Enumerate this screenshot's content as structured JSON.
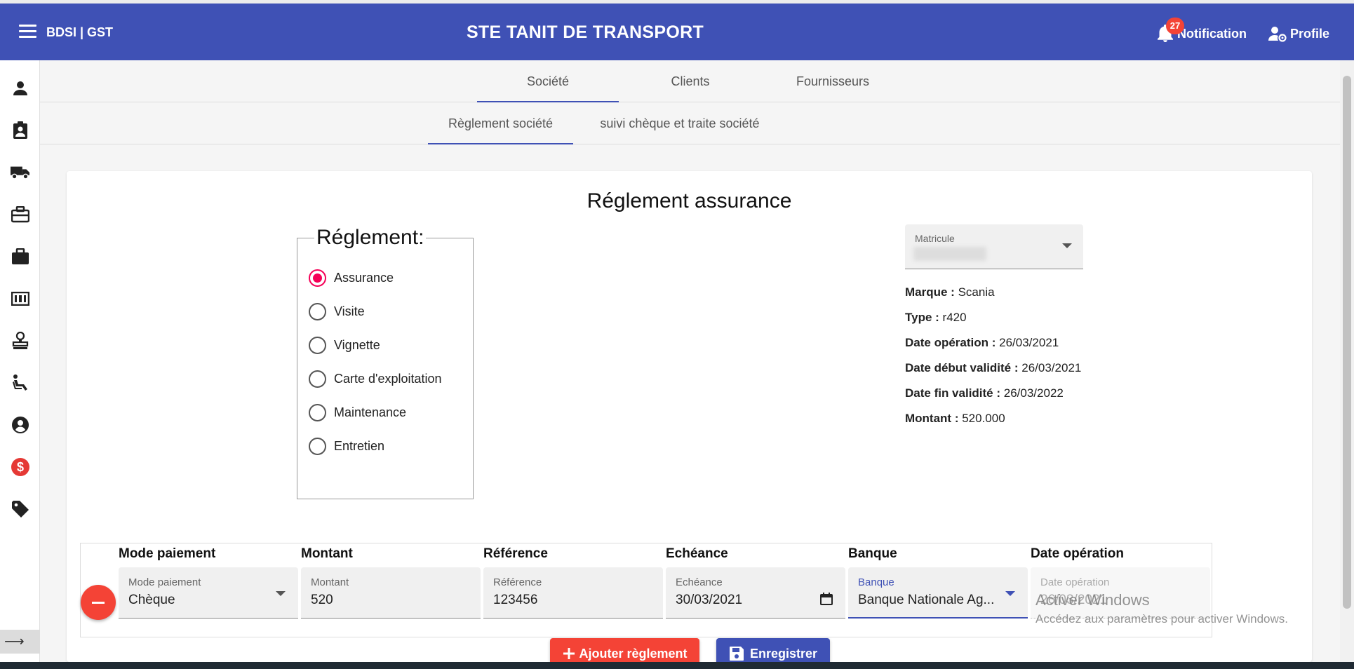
{
  "appbar": {
    "brand": "BDSI | GST",
    "title": "STE TANIT DE TRANSPORT",
    "notification_count": "27",
    "notification_label": "Notification",
    "profile_label": "Profile",
    "color": "#3f51b5"
  },
  "sidebar": {
    "icons": [
      "person-icon",
      "assignment-ind-icon",
      "truck-icon",
      "toolbox-icon",
      "briefcase-icon",
      "pallet-icon",
      "stamp-icon",
      "seat-icon",
      "account-circle-icon",
      "dollar-icon",
      "tag-icon"
    ],
    "collapse_label": "⟶"
  },
  "tabs": {
    "main": [
      "Société",
      "Clients",
      "Fournisseurs"
    ],
    "sub": [
      "Règlement société",
      "suivi chèque et traite société"
    ]
  },
  "card": {
    "title": "Réglement assurance"
  },
  "reglement": {
    "legend": "Réglement:",
    "options": [
      "Assurance",
      "Visite",
      "Vignette",
      "Carte d'exploitation",
      "Maintenance",
      "Entretien"
    ],
    "selected": "Assurance"
  },
  "vehicle": {
    "matricule_label": "Matricule",
    "marque_label": "Marque :",
    "marque": "Scania",
    "type_label": "Type :",
    "type": "r420",
    "date_operation_label": "Date opération :",
    "date_operation": "26/03/2021",
    "date_debut_label": "Date début validité :",
    "date_debut": "26/03/2021",
    "date_fin_label": "Date fin validité :",
    "date_fin": "26/03/2022",
    "montant_label": "Montant :",
    "montant": "520.000"
  },
  "payment": {
    "headers": [
      "Mode paiement",
      "Montant",
      "Référence",
      "Echéance",
      "Banque",
      "Date opération"
    ],
    "row": {
      "mode_label": "Mode paiement",
      "mode": "Chèque",
      "montant_label": "Montant",
      "montant": "520",
      "reference_label": "Référence",
      "reference": "123456",
      "echeance_label": "Echéance",
      "echeance": "30/03/2021",
      "banque_label": "Banque",
      "banque": "Banque Nationale Ag...",
      "date_label": "Date opération",
      "date": "26/03/2021"
    }
  },
  "buttons": {
    "add": "Ajouter règlement",
    "save": "Enregistrer"
  },
  "watermark": {
    "line1": "Activer Windows",
    "line2": "Accédez aux paramètres pour activer Windows."
  }
}
